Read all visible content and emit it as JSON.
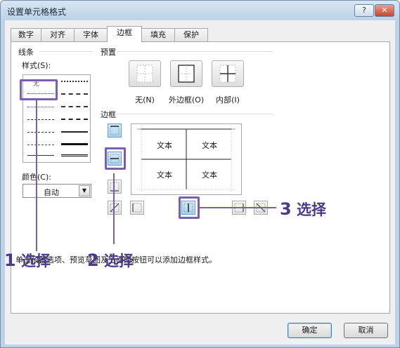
{
  "window": {
    "title": "设置单元格格式",
    "help_label": "?",
    "close_label": "✕"
  },
  "tabs": [
    {
      "label": "数字"
    },
    {
      "label": "对齐"
    },
    {
      "label": "字体"
    },
    {
      "label": "边框"
    },
    {
      "label": "填充"
    },
    {
      "label": "保护"
    }
  ],
  "line": {
    "group_label": "线条",
    "style_label": "样式(S):",
    "none_label": "无",
    "color_label": "颜色(C):",
    "color_value": "自动"
  },
  "presets": {
    "group_label": "预置",
    "items": [
      {
        "label": "无(N)"
      },
      {
        "label": "外边框(O)"
      },
      {
        "label": "内部(I)"
      }
    ]
  },
  "border": {
    "group_label": "边框",
    "preview_cells": [
      "文本",
      "文本",
      "文本",
      "文本"
    ]
  },
  "hint": "单击预置选项、预览草图及上面的按钮可以添加边框样式。",
  "annotations": [
    {
      "number": "1",
      "text": "选择"
    },
    {
      "number": "2",
      "text": "选择"
    },
    {
      "number": "3",
      "text": "选择"
    }
  ],
  "buttons": {
    "ok_label": "确定",
    "cancel_label": "取消"
  },
  "colors": {
    "annotation": "#4d3a86",
    "highlight": "#7a5fb0",
    "title_bar": "#bcd2e8"
  }
}
